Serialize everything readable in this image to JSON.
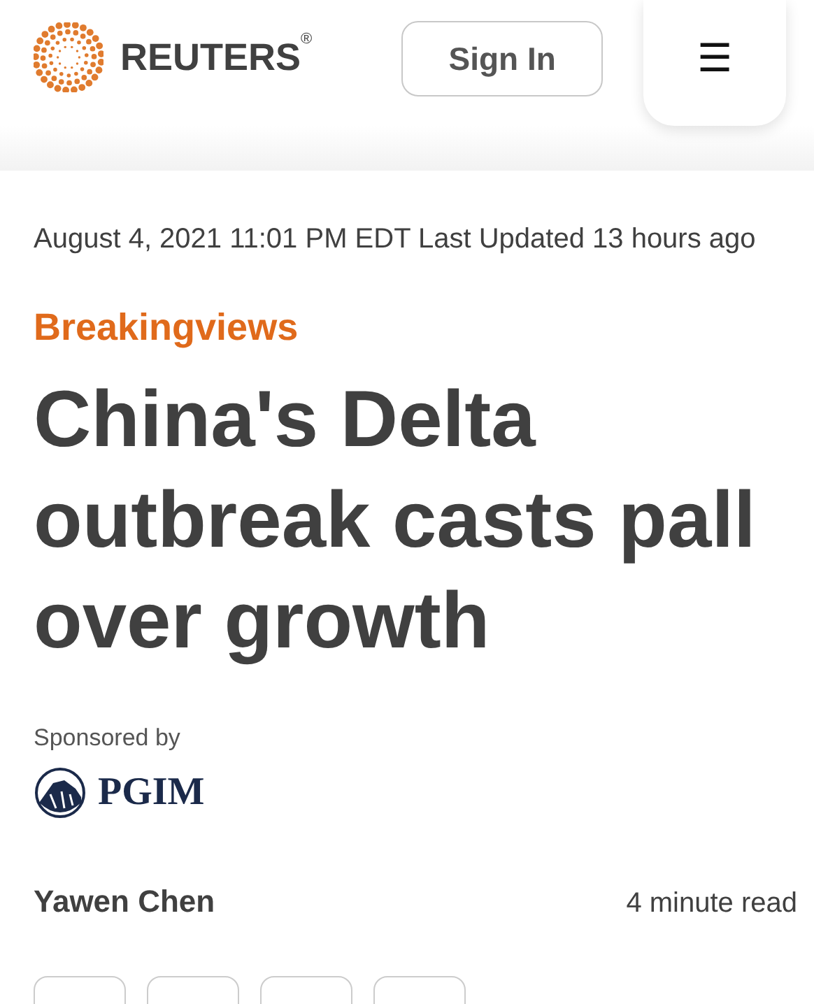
{
  "header": {
    "logo": {
      "name": "REUTERS",
      "mark": "®"
    },
    "sign_in": "Sign In",
    "menu": "☰"
  },
  "article": {
    "dateline": "August 4, 2021 11:01 PM EDT Last Updated 13 hours ago",
    "section": "Breakingviews",
    "headline": "China's Delta outbreak casts pall over growth",
    "sponsor": {
      "label": "Sponsored by",
      "name": "PGIM"
    },
    "author": "Yawen Chen",
    "read_time": "4 minute read"
  }
}
